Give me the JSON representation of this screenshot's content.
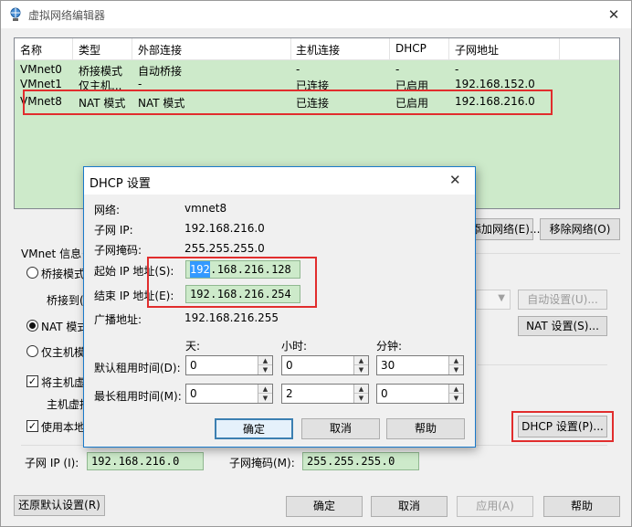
{
  "window": {
    "title": "虚拟网络编辑器"
  },
  "netlist": {
    "headers": [
      "名称",
      "类型",
      "外部连接",
      "主机连接",
      "DHCP",
      "子网地址"
    ],
    "rows": [
      [
        "VMnet0",
        "桥接模式",
        "自动桥接",
        "-",
        "-",
        "-"
      ],
      [
        "VMnet1",
        "仅主机...",
        "-",
        "已连接",
        "已启用",
        "192.168.152.0"
      ],
      [
        "VMnet8",
        "NAT 模式",
        "NAT 模式",
        "已连接",
        "已启用",
        "192.168.216.0"
      ]
    ]
  },
  "main": {
    "add_network": "添加网络(E)...",
    "remove_network": "移除网络(O)",
    "vmnet_info": "VMnet 信息",
    "bridge_mode": "桥接模式",
    "bridge_to": "桥接到(T",
    "auto_settings": "自动设置(U)...",
    "nat_mode": "NAT 模式",
    "nat_settings": "NAT 设置(S)...",
    "host_only": "仅主机模",
    "connect_host_adapter": "将主机虚",
    "host_adapter_name": "主机虚拟",
    "use_local_dhcp": "使用本地",
    "dhcp_settings": "DHCP 设置(P)...",
    "subnet_ip_label": "子网 IP (I):",
    "subnet_ip": [
      "192",
      "168",
      "216",
      "0"
    ],
    "subnet_mask_label": "子网掩码(M):",
    "subnet_mask": [
      "255",
      "255",
      "255",
      "0"
    ],
    "restore_defaults": "还原默认设置(R)",
    "ok": "确定",
    "cancel": "取消",
    "apply": "应用(A)",
    "help": "帮助"
  },
  "dhcp": {
    "title": "DHCP 设置",
    "network_label": "网络:",
    "network_value": "vmnet8",
    "subnet_ip_label": "子网 IP:",
    "subnet_ip_value": "192.168.216.0",
    "subnet_mask_label": "子网掩码:",
    "subnet_mask_value": "255.255.255.0",
    "start_ip_label": "起始 IP 地址(S):",
    "start_ip": [
      "192",
      "168",
      "216",
      "128"
    ],
    "end_ip_label": "结束 IP 地址(E):",
    "end_ip": [
      "192",
      "168",
      "216",
      "254"
    ],
    "broadcast_label": "广播地址:",
    "broadcast_value": "192.168.216.255",
    "col_days": "天:",
    "col_hours": "小时:",
    "col_minutes": "分钟:",
    "default_lease_label": "默认租用时间(D):",
    "default_lease": [
      "0",
      "0",
      "30"
    ],
    "max_lease_label": "最长租用时间(M):",
    "max_lease": [
      "0",
      "2",
      "0"
    ],
    "ok": "确定",
    "cancel": "取消",
    "help": "帮助"
  },
  "colors": {
    "highlight_green": "#cdeaca",
    "annotation_red": "#e12d2d",
    "selection_blue": "#3399ff"
  }
}
